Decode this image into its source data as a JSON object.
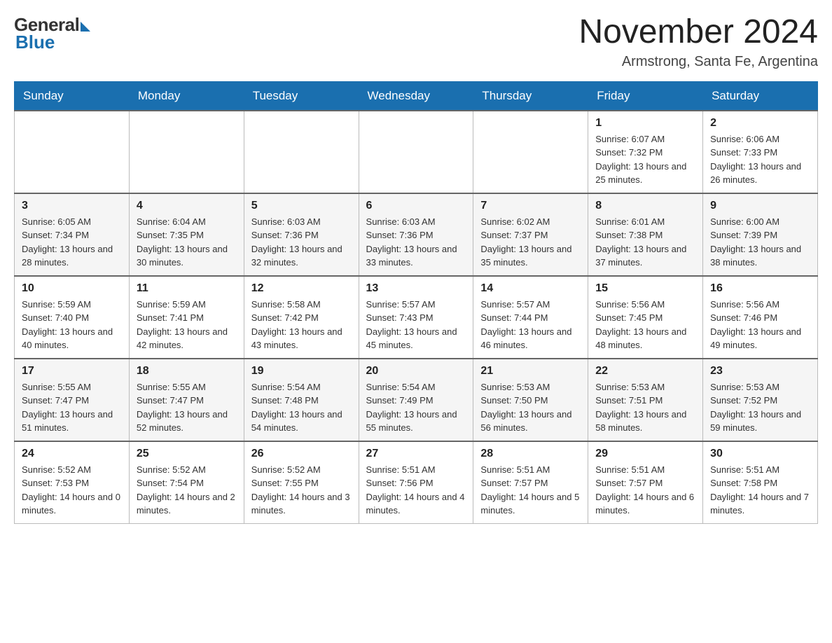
{
  "header": {
    "logo_general": "General",
    "logo_blue": "Blue",
    "main_title": "November 2024",
    "subtitle": "Armstrong, Santa Fe, Argentina"
  },
  "weekdays": [
    "Sunday",
    "Monday",
    "Tuesday",
    "Wednesday",
    "Thursday",
    "Friday",
    "Saturday"
  ],
  "weeks": [
    [
      {
        "day": "",
        "info": ""
      },
      {
        "day": "",
        "info": ""
      },
      {
        "day": "",
        "info": ""
      },
      {
        "day": "",
        "info": ""
      },
      {
        "day": "",
        "info": ""
      },
      {
        "day": "1",
        "info": "Sunrise: 6:07 AM\nSunset: 7:32 PM\nDaylight: 13 hours and 25 minutes."
      },
      {
        "day": "2",
        "info": "Sunrise: 6:06 AM\nSunset: 7:33 PM\nDaylight: 13 hours and 26 minutes."
      }
    ],
    [
      {
        "day": "3",
        "info": "Sunrise: 6:05 AM\nSunset: 7:34 PM\nDaylight: 13 hours and 28 minutes."
      },
      {
        "day": "4",
        "info": "Sunrise: 6:04 AM\nSunset: 7:35 PM\nDaylight: 13 hours and 30 minutes."
      },
      {
        "day": "5",
        "info": "Sunrise: 6:03 AM\nSunset: 7:36 PM\nDaylight: 13 hours and 32 minutes."
      },
      {
        "day": "6",
        "info": "Sunrise: 6:03 AM\nSunset: 7:36 PM\nDaylight: 13 hours and 33 minutes."
      },
      {
        "day": "7",
        "info": "Sunrise: 6:02 AM\nSunset: 7:37 PM\nDaylight: 13 hours and 35 minutes."
      },
      {
        "day": "8",
        "info": "Sunrise: 6:01 AM\nSunset: 7:38 PM\nDaylight: 13 hours and 37 minutes."
      },
      {
        "day": "9",
        "info": "Sunrise: 6:00 AM\nSunset: 7:39 PM\nDaylight: 13 hours and 38 minutes."
      }
    ],
    [
      {
        "day": "10",
        "info": "Sunrise: 5:59 AM\nSunset: 7:40 PM\nDaylight: 13 hours and 40 minutes."
      },
      {
        "day": "11",
        "info": "Sunrise: 5:59 AM\nSunset: 7:41 PM\nDaylight: 13 hours and 42 minutes."
      },
      {
        "day": "12",
        "info": "Sunrise: 5:58 AM\nSunset: 7:42 PM\nDaylight: 13 hours and 43 minutes."
      },
      {
        "day": "13",
        "info": "Sunrise: 5:57 AM\nSunset: 7:43 PM\nDaylight: 13 hours and 45 minutes."
      },
      {
        "day": "14",
        "info": "Sunrise: 5:57 AM\nSunset: 7:44 PM\nDaylight: 13 hours and 46 minutes."
      },
      {
        "day": "15",
        "info": "Sunrise: 5:56 AM\nSunset: 7:45 PM\nDaylight: 13 hours and 48 minutes."
      },
      {
        "day": "16",
        "info": "Sunrise: 5:56 AM\nSunset: 7:46 PM\nDaylight: 13 hours and 49 minutes."
      }
    ],
    [
      {
        "day": "17",
        "info": "Sunrise: 5:55 AM\nSunset: 7:47 PM\nDaylight: 13 hours and 51 minutes."
      },
      {
        "day": "18",
        "info": "Sunrise: 5:55 AM\nSunset: 7:47 PM\nDaylight: 13 hours and 52 minutes."
      },
      {
        "day": "19",
        "info": "Sunrise: 5:54 AM\nSunset: 7:48 PM\nDaylight: 13 hours and 54 minutes."
      },
      {
        "day": "20",
        "info": "Sunrise: 5:54 AM\nSunset: 7:49 PM\nDaylight: 13 hours and 55 minutes."
      },
      {
        "day": "21",
        "info": "Sunrise: 5:53 AM\nSunset: 7:50 PM\nDaylight: 13 hours and 56 minutes."
      },
      {
        "day": "22",
        "info": "Sunrise: 5:53 AM\nSunset: 7:51 PM\nDaylight: 13 hours and 58 minutes."
      },
      {
        "day": "23",
        "info": "Sunrise: 5:53 AM\nSunset: 7:52 PM\nDaylight: 13 hours and 59 minutes."
      }
    ],
    [
      {
        "day": "24",
        "info": "Sunrise: 5:52 AM\nSunset: 7:53 PM\nDaylight: 14 hours and 0 minutes."
      },
      {
        "day": "25",
        "info": "Sunrise: 5:52 AM\nSunset: 7:54 PM\nDaylight: 14 hours and 2 minutes."
      },
      {
        "day": "26",
        "info": "Sunrise: 5:52 AM\nSunset: 7:55 PM\nDaylight: 14 hours and 3 minutes."
      },
      {
        "day": "27",
        "info": "Sunrise: 5:51 AM\nSunset: 7:56 PM\nDaylight: 14 hours and 4 minutes."
      },
      {
        "day": "28",
        "info": "Sunrise: 5:51 AM\nSunset: 7:57 PM\nDaylight: 14 hours and 5 minutes."
      },
      {
        "day": "29",
        "info": "Sunrise: 5:51 AM\nSunset: 7:57 PM\nDaylight: 14 hours and 6 minutes."
      },
      {
        "day": "30",
        "info": "Sunrise: 5:51 AM\nSunset: 7:58 PM\nDaylight: 14 hours and 7 minutes."
      }
    ]
  ]
}
